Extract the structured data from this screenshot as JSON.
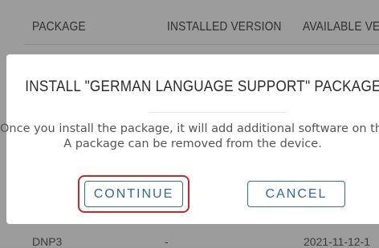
{
  "table": {
    "headers": [
      "PACKAGE",
      "INSTALLED VERSION",
      "AVAILABLE VER"
    ],
    "row": {
      "name": "DNP3",
      "installed": "-",
      "available": "2021-11-12-1"
    }
  },
  "modal": {
    "title": "INSTALL \"GERMAN LANGUAGE SUPPORT\" PACKAGE?",
    "message_line1": "Once you install the package, it will add additional software on the",
    "message_line2": "A package can be removed from the device.",
    "continue_label": "CONTINUE",
    "cancel_label": "CANCEL"
  },
  "colors": {
    "accent": "#2d6aa8",
    "highlight": "#c62828",
    "overlay": "#9a9a9a"
  }
}
